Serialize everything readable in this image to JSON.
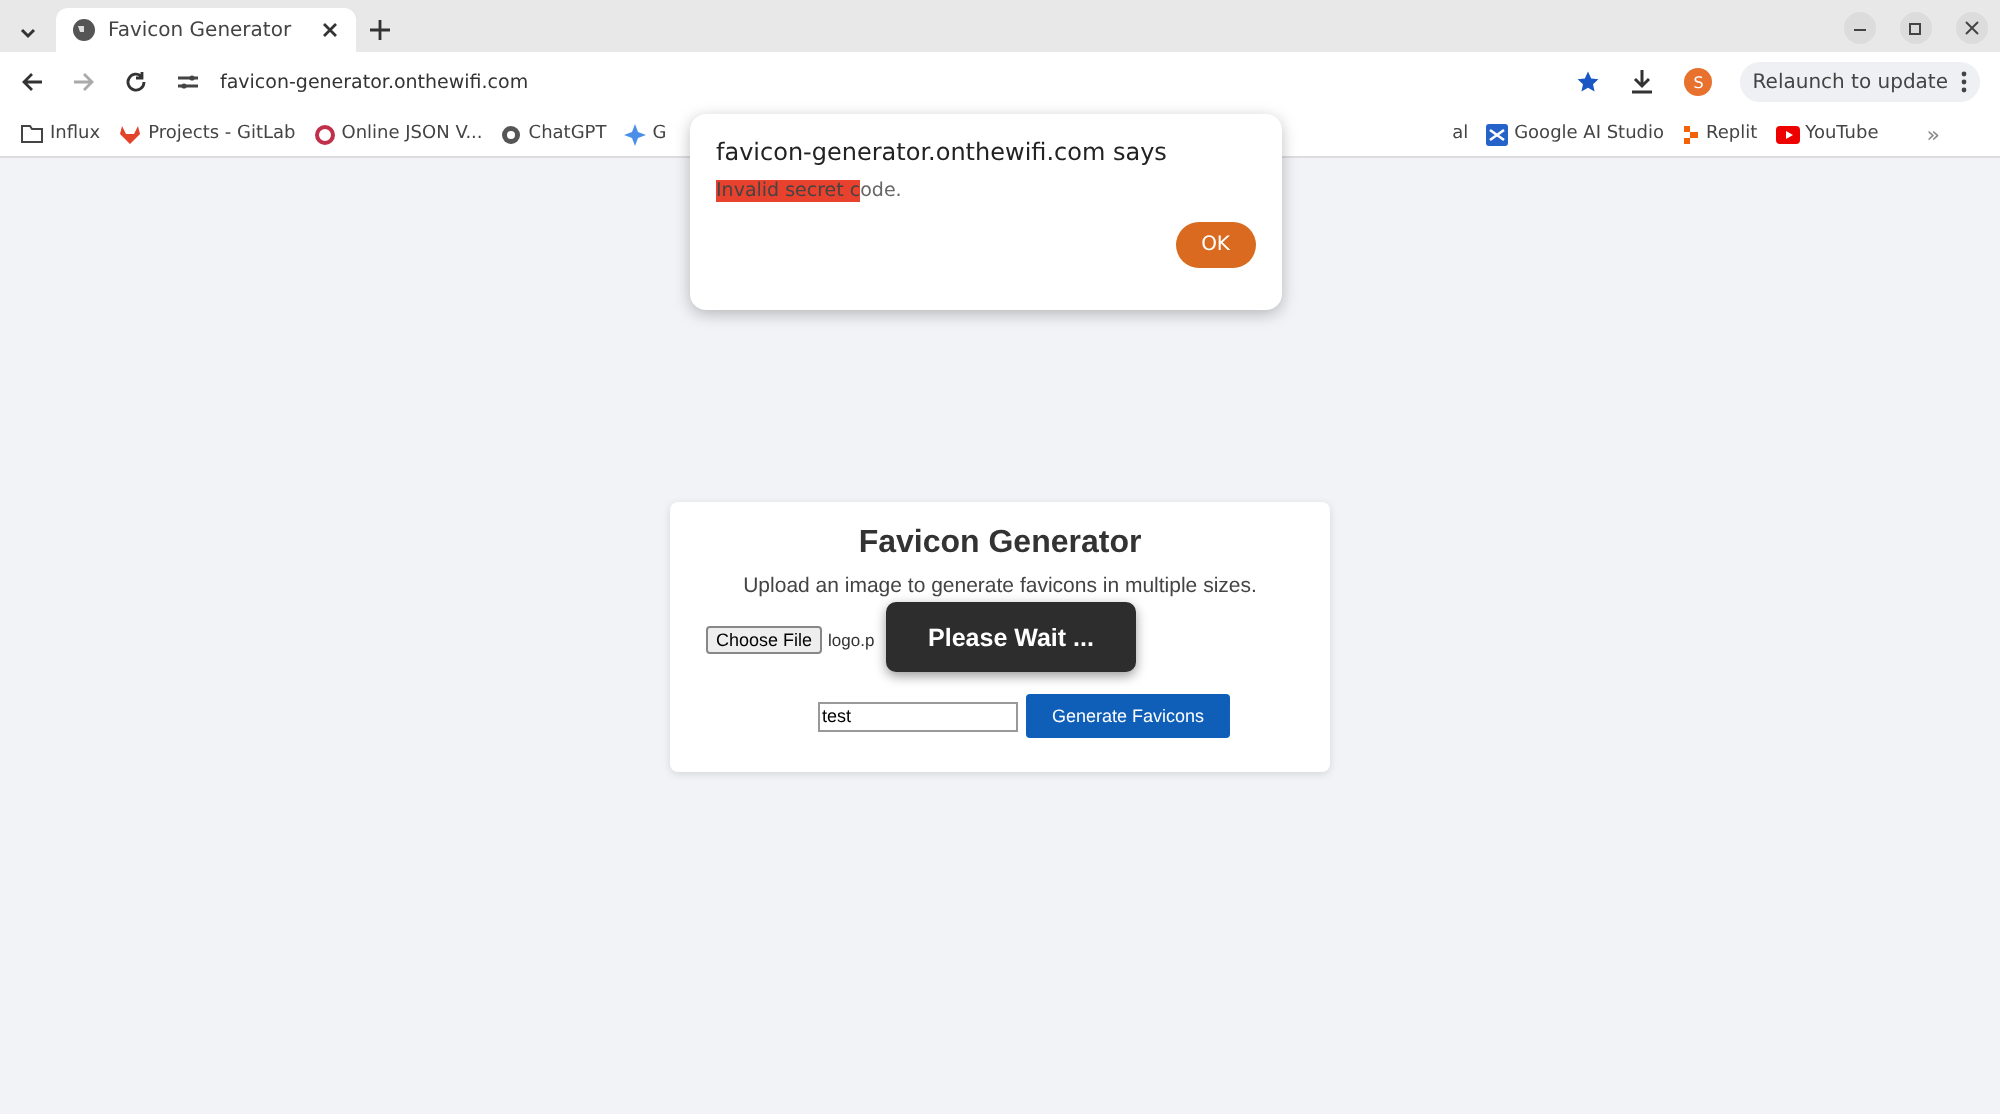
{
  "tabs": [
    {
      "title": "Favicon Generator",
      "selected": true
    }
  ],
  "address": "favicon-generator.onthewifi.com",
  "profile": "S",
  "relaunch": "Relaunch to update",
  "bookmarks_left": [
    {
      "label": "Influx",
      "kind": "folder"
    },
    {
      "label": "Projects - GitLab",
      "kind": "gitlab"
    },
    {
      "label": "Online JSON V...",
      "kind": "ring"
    },
    {
      "label": "ChatGPT",
      "kind": "gpt"
    },
    {
      "label": "G",
      "kind": "sparkle"
    }
  ],
  "bookmarks_right": [
    {
      "label": "al",
      "kind": "none"
    },
    {
      "label": "Google AI Studio",
      "kind": "studio"
    },
    {
      "label": "Replit",
      "kind": "replit"
    },
    {
      "label": "YouTube",
      "kind": "youtube"
    }
  ],
  "more": "»",
  "dialog": {
    "title": "favicon-generator.onthewifi.com says",
    "highlighted": "Invalid secret c",
    "rest": "ode.",
    "button": "OK"
  },
  "card": {
    "title": "Favicon Generator",
    "subtitle": "Upload an image to generate favicons in multiple sizes.",
    "file_button": "Choose File",
    "file_name": "logo.p",
    "code_value": "test",
    "submit": "Generate Favicons"
  },
  "toast": "Please Wait ..."
}
